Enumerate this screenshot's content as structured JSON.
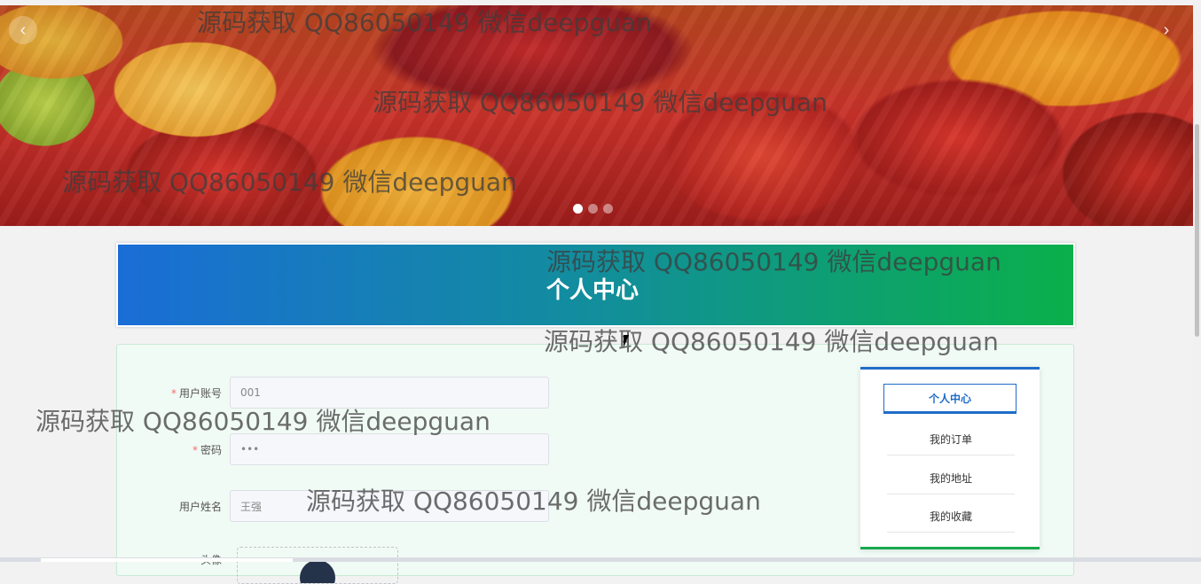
{
  "banner": {
    "prev_icon": "‹",
    "next_icon": "›",
    "slide_count": 3,
    "active_slide": 1
  },
  "watermark_text": "源码获取 QQ86050149 微信deepguan",
  "page_title": "个人中心",
  "form": {
    "account": {
      "label": "用户账号",
      "value": "001",
      "required": true
    },
    "password": {
      "label": "密码",
      "value": "•••",
      "required": true
    },
    "name": {
      "label": "用户姓名",
      "value": "王强",
      "required": false
    },
    "avatar": {
      "label": "头像"
    }
  },
  "side_menu": {
    "items": [
      {
        "label": "个人中心",
        "active": true
      },
      {
        "label": "我的订单",
        "active": false
      },
      {
        "label": "我的地址",
        "active": false
      },
      {
        "label": "我的收藏",
        "active": false
      }
    ]
  },
  "colors": {
    "accent_blue": "#1f6cc8",
    "accent_green": "#1aa84c",
    "required": "#f56c6c"
  }
}
